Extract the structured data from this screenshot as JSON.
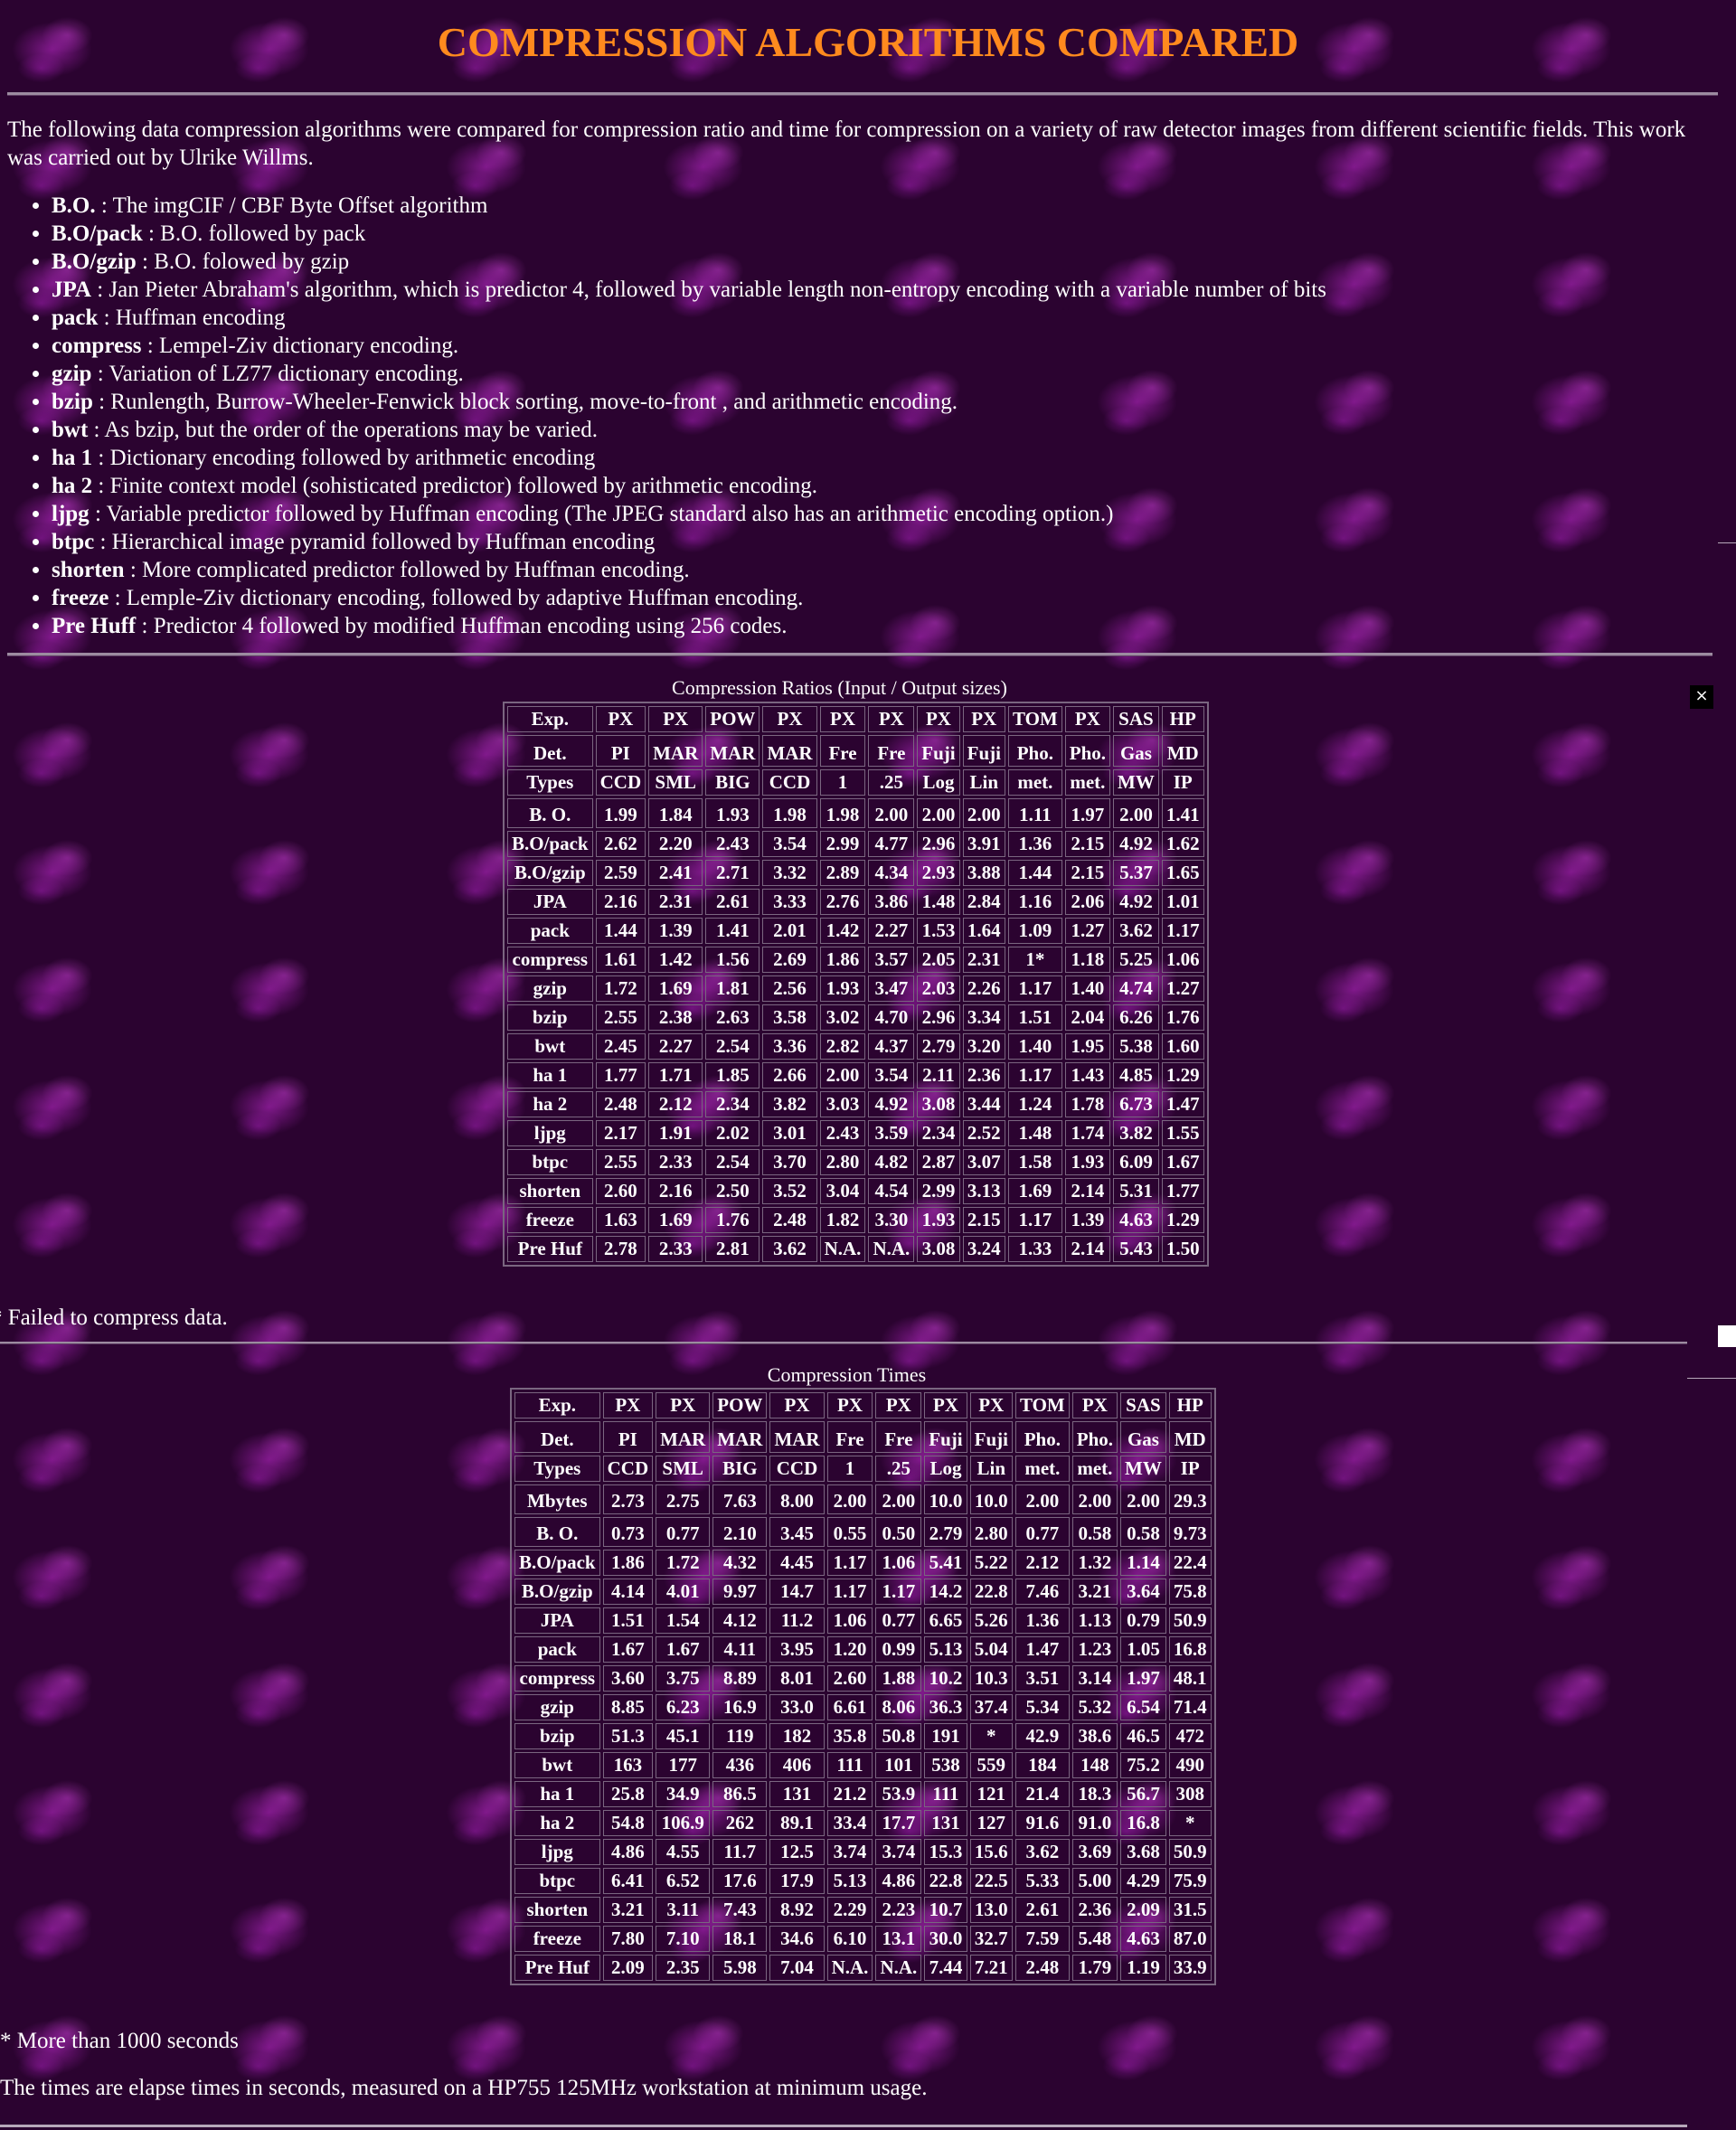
{
  "title": "COMPRESSION ALGORITHMS COMPARED",
  "intro": "The following data compression algorithms were compared for compression ratio and time for compression on a variety of raw detector images from different scientific fields. This work was carried out by Ulrike Willms.",
  "algorithms": [
    {
      "name": "B.O.",
      "desc": " : The imgCIF / CBF Byte Offset algorithm"
    },
    {
      "name": "B.O/pack",
      "desc": " : B.O. followed by pack"
    },
    {
      "name": "B.O/gzip",
      "desc": " : B.O. folowed by gzip"
    },
    {
      "name": "JPA",
      "desc": " : Jan Pieter Abraham's algorithm, which is predictor 4, followed by variable length non-entropy encoding with a variable number of bits"
    },
    {
      "name": "pack",
      "desc": " : Huffman encoding"
    },
    {
      "name": "compress",
      "desc": " : Lempel-Ziv dictionary encoding."
    },
    {
      "name": "gzip",
      "desc": " : Variation of LZ77 dictionary encoding."
    },
    {
      "name": "bzip",
      "desc": " : Runlength, Burrow-Wheeler-Fenwick block sorting, move-to-front , and arithmetic encoding."
    },
    {
      "name": "bwt",
      "desc": " : As bzip, but the order of the operations may be varied."
    },
    {
      "name": "ha 1",
      "desc": " : Dictionary encoding followed by arithmetic encoding"
    },
    {
      "name": "ha 2",
      "desc": " : Finite context model (sohisticated predictor) followed by arithmetic encoding."
    },
    {
      "name": "ljpg",
      "desc": " : Variable predictor followed by Huffman encoding (The JPEG standard also has an arithmetic encoding option.)"
    },
    {
      "name": "btpc",
      "desc": " : Hierarchical image pyramid followed by Huffman encoding"
    },
    {
      "name": "shorten",
      "desc": " : More complicated predictor followed by Huffman encoding."
    },
    {
      "name": "freeze",
      "desc": " : Lemple-Ziv dictionary encoding, followed by adaptive Huffman encoding."
    },
    {
      "name": "Pre Huff",
      "desc": " : Predictor 4 followed by modified Huffman encoding using 256 codes."
    }
  ],
  "header_rows": [
    [
      "Exp.",
      "PX",
      "PX",
      "POW",
      "PX",
      "PX",
      "PX",
      "PX",
      "PX",
      "TOM",
      "PX",
      "SAS",
      "HP"
    ],
    [
      "Det.",
      "PI",
      "MAR",
      "MAR",
      "MAR",
      "Fre",
      "Fre",
      "Fuji",
      "Fuji",
      "Pho.",
      "Pho.",
      "Gas",
      "MD"
    ],
    [
      "Types",
      "CCD",
      "SML",
      "BIG",
      "CCD",
      "1",
      ".25",
      "Log",
      "Lin",
      "met.",
      "met.",
      "MW",
      "IP"
    ]
  ],
  "ratios": {
    "caption": "Compression Ratios (Input / Output sizes)",
    "rows": [
      [
        "B. O.",
        "1.99",
        "1.84",
        "1.93",
        "1.98",
        "1.98",
        "2.00",
        "2.00",
        "2.00",
        "1.11",
        "1.97",
        "2.00",
        "1.41"
      ],
      [
        "B.O/pack",
        "2.62",
        "2.20",
        "2.43",
        "3.54",
        "2.99",
        "4.77",
        "2.96",
        "3.91",
        "1.36",
        "2.15",
        "4.92",
        "1.62"
      ],
      [
        "B.O/gzip",
        "2.59",
        "2.41",
        "2.71",
        "3.32",
        "2.89",
        "4.34",
        "2.93",
        "3.88",
        "1.44",
        "2.15",
        "5.37",
        "1.65"
      ],
      [
        "JPA",
        "2.16",
        "2.31",
        "2.61",
        "3.33",
        "2.76",
        "3.86",
        "1.48",
        "2.84",
        "1.16",
        "2.06",
        "4.92",
        "1.01"
      ],
      [
        "pack",
        "1.44",
        "1.39",
        "1.41",
        "2.01",
        "1.42",
        "2.27",
        "1.53",
        "1.64",
        "1.09",
        "1.27",
        "3.62",
        "1.17"
      ],
      [
        "compress",
        "1.61",
        "1.42",
        "1.56",
        "2.69",
        "1.86",
        "3.57",
        "2.05",
        "2.31",
        "1*",
        "1.18",
        "5.25",
        "1.06"
      ],
      [
        "gzip",
        "1.72",
        "1.69",
        "1.81",
        "2.56",
        "1.93",
        "3.47",
        "2.03",
        "2.26",
        "1.17",
        "1.40",
        "4.74",
        "1.27"
      ],
      [
        "bzip",
        "2.55",
        "2.38",
        "2.63",
        "3.58",
        "3.02",
        "4.70",
        "2.96",
        "3.34",
        "1.51",
        "2.04",
        "6.26",
        "1.76"
      ],
      [
        "bwt",
        "2.45",
        "2.27",
        "2.54",
        "3.36",
        "2.82",
        "4.37",
        "2.79",
        "3.20",
        "1.40",
        "1.95",
        "5.38",
        "1.60"
      ],
      [
        "ha 1",
        "1.77",
        "1.71",
        "1.85",
        "2.66",
        "2.00",
        "3.54",
        "2.11",
        "2.36",
        "1.17",
        "1.43",
        "4.85",
        "1.29"
      ],
      [
        "ha 2",
        "2.48",
        "2.12",
        "2.34",
        "3.82",
        "3.03",
        "4.92",
        "3.08",
        "3.44",
        "1.24",
        "1.78",
        "6.73",
        "1.47"
      ],
      [
        "ljpg",
        "2.17",
        "1.91",
        "2.02",
        "3.01",
        "2.43",
        "3.59",
        "2.34",
        "2.52",
        "1.48",
        "1.74",
        "3.82",
        "1.55"
      ],
      [
        "btpc",
        "2.55",
        "2.33",
        "2.54",
        "3.70",
        "2.80",
        "4.82",
        "2.87",
        "3.07",
        "1.58",
        "1.93",
        "6.09",
        "1.67"
      ],
      [
        "shorten",
        "2.60",
        "2.16",
        "2.50",
        "3.52",
        "3.04",
        "4.54",
        "2.99",
        "3.13",
        "1.69",
        "2.14",
        "5.31",
        "1.77"
      ],
      [
        "freeze",
        "1.63",
        "1.69",
        "1.76",
        "2.48",
        "1.82",
        "3.30",
        "1.93",
        "2.15",
        "1.17",
        "1.39",
        "4.63",
        "1.29"
      ],
      [
        "Pre Huf",
        "2.78",
        "2.33",
        "2.81",
        "3.62",
        "N.A.",
        "N.A.",
        "3.08",
        "3.24",
        "1.33",
        "2.14",
        "5.43",
        "1.50"
      ]
    ],
    "note": "* Failed to compress data."
  },
  "times": {
    "caption": "Compression Times",
    "mbytes_row": [
      "Mbytes",
      "2.73",
      "2.75",
      "7.63",
      "8.00",
      "2.00",
      "2.00",
      "10.0",
      "10.0",
      "2.00",
      "2.00",
      "2.00",
      "29.3"
    ],
    "rows": [
      [
        "B. O.",
        "0.73",
        "0.77",
        "2.10",
        "3.45",
        "0.55",
        "0.50",
        "2.79",
        "2.80",
        "0.77",
        "0.58",
        "0.58",
        "9.73"
      ],
      [
        "B.O/pack",
        "1.86",
        "1.72",
        "4.32",
        "4.45",
        "1.17",
        "1.06",
        "5.41",
        "5.22",
        "2.12",
        "1.32",
        "1.14",
        "22.4"
      ],
      [
        "B.O/gzip",
        "4.14",
        "4.01",
        "9.97",
        "14.7",
        "1.17",
        "1.17",
        "14.2",
        "22.8",
        "7.46",
        "3.21",
        "3.64",
        "75.8"
      ],
      [
        "JPA",
        "1.51",
        "1.54",
        "4.12",
        "11.2",
        "1.06",
        "0.77",
        "6.65",
        "5.26",
        "1.36",
        "1.13",
        "0.79",
        "50.9"
      ],
      [
        "pack",
        "1.67",
        "1.67",
        "4.11",
        "3.95",
        "1.20",
        "0.99",
        "5.13",
        "5.04",
        "1.47",
        "1.23",
        "1.05",
        "16.8"
      ],
      [
        "compress",
        "3.60",
        "3.75",
        "8.89",
        "8.01",
        "2.60",
        "1.88",
        "10.2",
        "10.3",
        "3.51",
        "3.14",
        "1.97",
        "48.1"
      ],
      [
        "gzip",
        "8.85",
        "6.23",
        "16.9",
        "33.0",
        "6.61",
        "8.06",
        "36.3",
        "37.4",
        "5.34",
        "5.32",
        "6.54",
        "71.4"
      ],
      [
        "bzip",
        "51.3",
        "45.1",
        "119",
        "182",
        "35.8",
        "50.8",
        "191",
        "*",
        "42.9",
        "38.6",
        "46.5",
        "472"
      ],
      [
        "bwt",
        "163",
        "177",
        "436",
        "406",
        "111",
        "101",
        "538",
        "559",
        "184",
        "148",
        "75.2",
        "490"
      ],
      [
        "ha 1",
        "25.8",
        "34.9",
        "86.5",
        "131",
        "21.2",
        "53.9",
        "111",
        "121",
        "21.4",
        "18.3",
        "56.7",
        "308"
      ],
      [
        "ha 2",
        "54.8",
        "106.9",
        "262",
        "89.1",
        "33.4",
        "17.7",
        "131",
        "127",
        "91.6",
        "91.0",
        "16.8",
        "*"
      ],
      [
        "ljpg",
        "4.86",
        "4.55",
        "11.7",
        "12.5",
        "3.74",
        "3.74",
        "15.3",
        "15.6",
        "3.62",
        "3.69",
        "3.68",
        "50.9"
      ],
      [
        "btpc",
        "6.41",
        "6.52",
        "17.6",
        "17.9",
        "5.13",
        "4.86",
        "22.8",
        "22.5",
        "5.33",
        "5.00",
        "4.29",
        "75.9"
      ],
      [
        "shorten",
        "3.21",
        "3.11",
        "7.43",
        "8.92",
        "2.29",
        "2.23",
        "10.7",
        "13.0",
        "2.61",
        "2.36",
        "2.09",
        "31.5"
      ],
      [
        "freeze",
        "7.80",
        "7.10",
        "18.1",
        "34.6",
        "6.10",
        "13.1",
        "30.0",
        "32.7",
        "7.59",
        "5.48",
        "4.63",
        "87.0"
      ],
      [
        "Pre Huf",
        "2.09",
        "2.35",
        "5.98",
        "7.04",
        "N.A.",
        "N.A.",
        "7.44",
        "7.21",
        "2.48",
        "1.79",
        "1.19",
        "33.9"
      ]
    ],
    "note1": "* More than 1000 seconds",
    "note2": "The times are elapse times in seconds, measured on a HP755 125MHz workstation at minimum usage."
  },
  "close_label": "×",
  "colors": {
    "title": "#ff8a1e",
    "background": "#2b0330",
    "text": "#ffffff",
    "rule": "#9c8ba0"
  }
}
